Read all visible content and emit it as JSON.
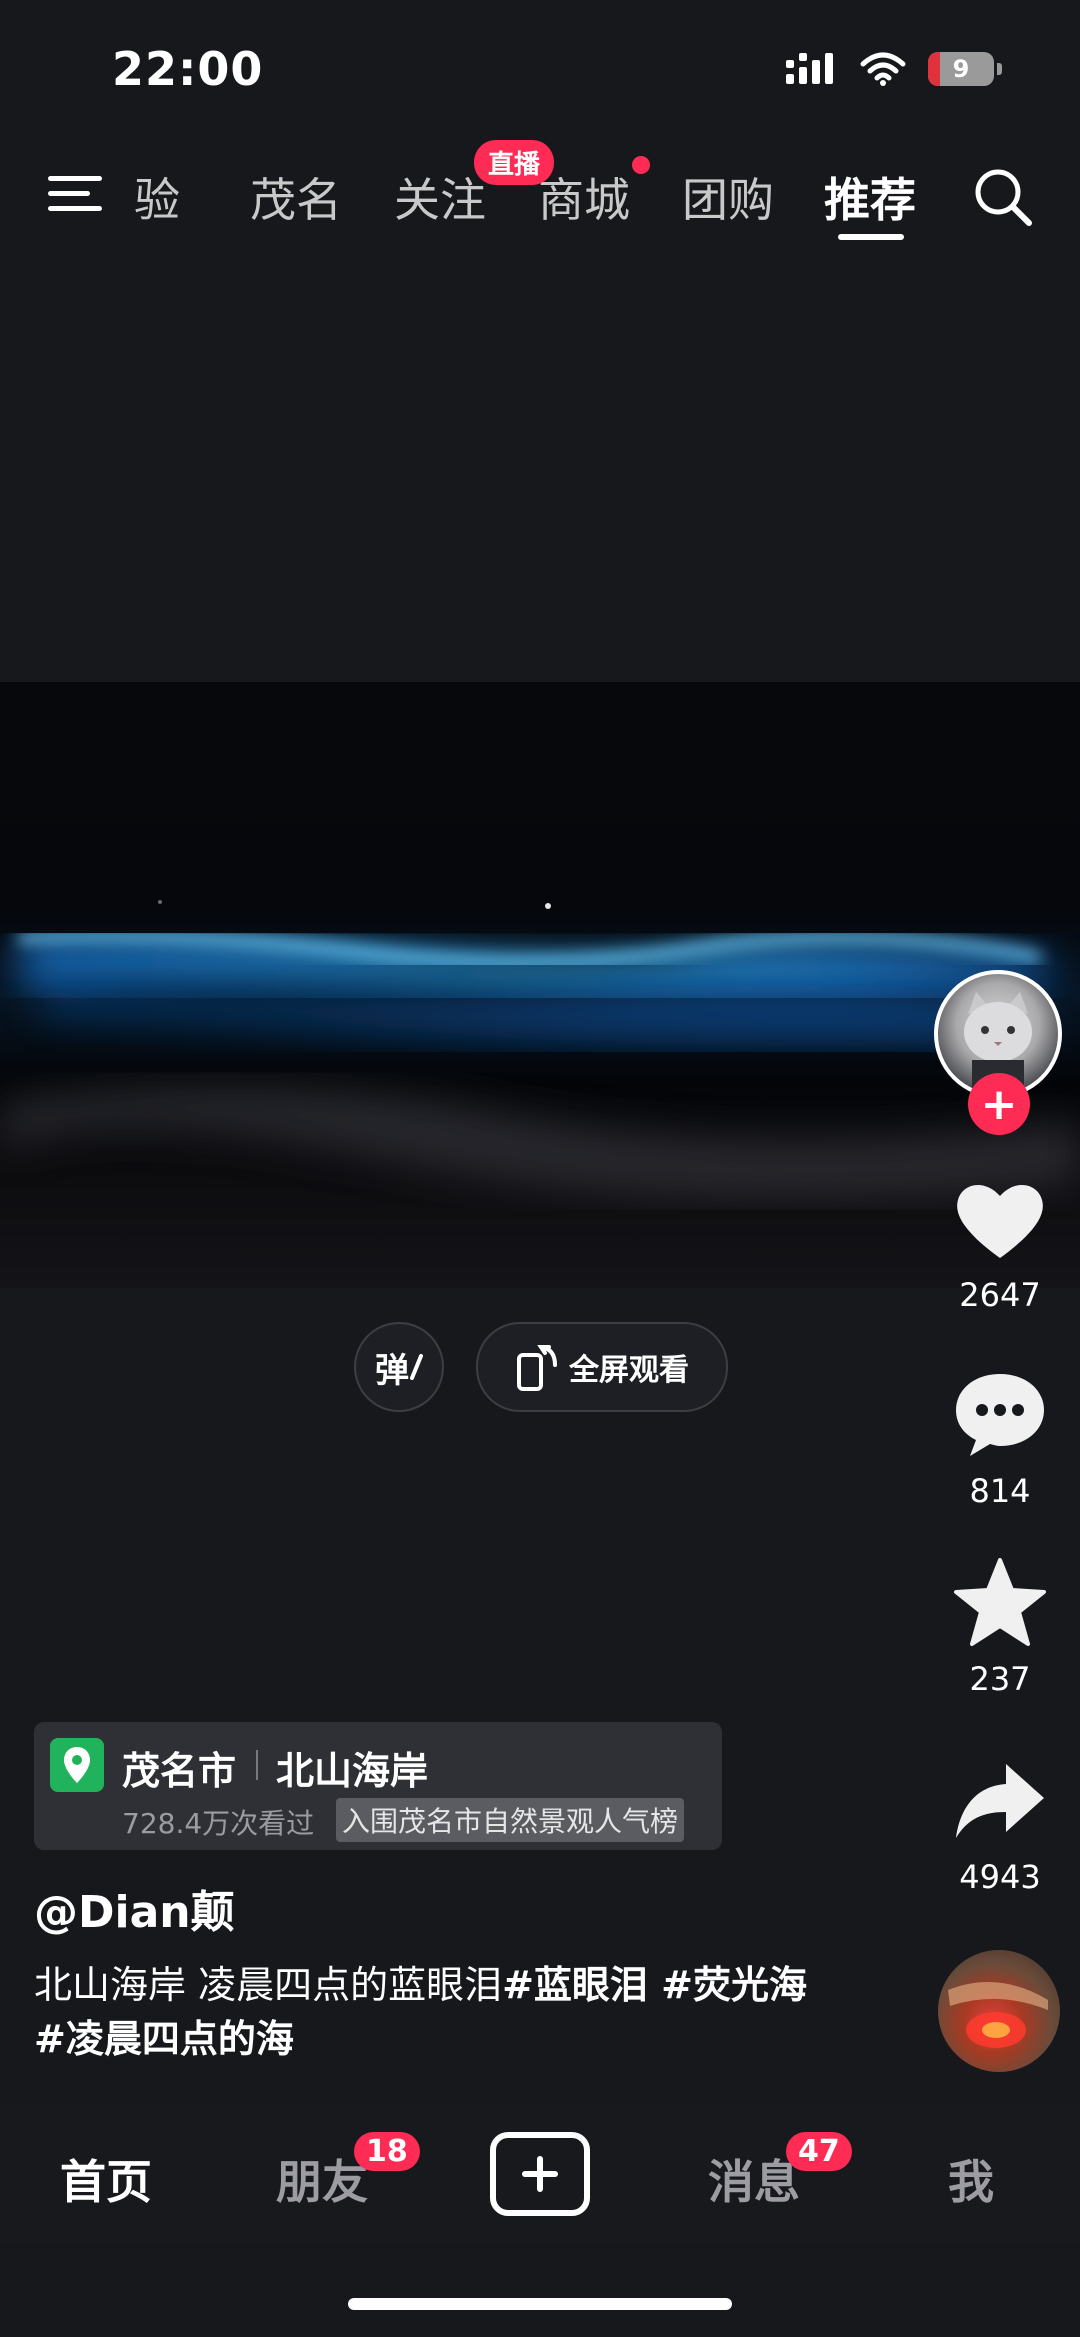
{
  "status_bar": {
    "time": "22:00",
    "battery": "9"
  },
  "top_nav": {
    "tabs": [
      {
        "label": "验"
      },
      {
        "label": "茂名"
      },
      {
        "label": "关注"
      },
      {
        "label": "商城"
      },
      {
        "label": "团购"
      },
      {
        "label": "推荐"
      }
    ],
    "active_tab": "推荐",
    "live_badge": "直播"
  },
  "video_controls": {
    "danmu_label": "弹",
    "fullscreen_label": "全屏观看"
  },
  "actions": {
    "likes": "2647",
    "comments": "814",
    "favorites": "237",
    "shares": "4943"
  },
  "location": {
    "city": "茂名市",
    "place": "北山海岸",
    "views": "728.4万次看过",
    "rank_tag": "入围茂名市自然景观人气榜"
  },
  "post": {
    "author": "@Dian颠",
    "caption_text": "北山海岸   凌晨四点的蓝眼泪",
    "hashtags": "#蓝眼泪 #荧光海 #凌晨四点的海"
  },
  "bottom_nav": {
    "home": "首页",
    "friends": "朋友",
    "friends_badge": "18",
    "messages": "消息",
    "messages_badge": "47",
    "me": "我"
  },
  "colors": {
    "accent": "#fe2c55",
    "background": "#16181c",
    "location_pin": "#21b35b",
    "wave_glow": "#22a6ff"
  }
}
